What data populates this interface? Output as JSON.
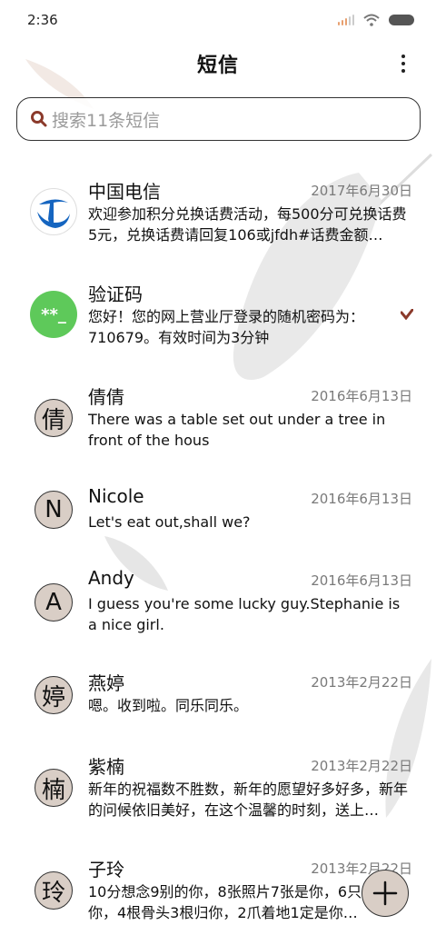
{
  "status_bar": {
    "time": "2:36"
  },
  "header": {
    "title": "短信"
  },
  "search": {
    "placeholder": "搜索11条短信"
  },
  "conversations": [
    {
      "name": "中国电信",
      "date": "2017年6月30日",
      "snippet": "欢迎参加积分兑换话费活动，每500分可兑换话费5元，兑换话费请回复106或jfdh#话费金额…",
      "avatar": "telecom-logo"
    },
    {
      "name": "验证码",
      "date": "",
      "snippet": "您好！您的网上营业厅登录的随机密码为：710679。有效时间为3分钟",
      "avatar": "**_"
    },
    {
      "name": "倩倩",
      "date": "2016年6月13日",
      "snippet": "There was a table set out under a tree in front of the hous",
      "avatar": "倩"
    },
    {
      "name": "Nicole",
      "date": "2016年6月13日",
      "snippet": "Let's eat out,shall we?",
      "avatar": "N"
    },
    {
      "name": "Andy",
      "date": "2016年6月13日",
      "snippet": "I guess you're some lucky guy.Stephanie is a nice girl.",
      "avatar": "A"
    },
    {
      "name": "燕婷",
      "date": "2013年2月22日",
      "snippet": "嗯。收到啦。同乐同乐。",
      "avatar": "婷"
    },
    {
      "name": "紫楠",
      "date": "2013年2月22日",
      "snippet": "新年的祝福数不胜数，新年的愿望好多好多，新年的问候依旧美好，在这个温馨的时刻，送上…",
      "avatar": "楠"
    },
    {
      "name": "子玲",
      "date": "2013年2月22日",
      "snippet": "10分想念9别的你，8张照片7张是你，6只…只像你，4根骨头3根归你，2爪着地1定是你…",
      "avatar": "玲"
    }
  ],
  "colors": {
    "accent_green": "#5ec95a",
    "telecom_blue": "#1565c0",
    "avatar_bg": "#d9cec6",
    "unread_mark": "#8b3a2b"
  },
  "icons": {
    "search": "search-icon",
    "more": "more-vertical-icon",
    "compose": "plus-icon",
    "wifi": "wifi-icon",
    "battery": "battery-icon",
    "signal": "signal-icon"
  }
}
